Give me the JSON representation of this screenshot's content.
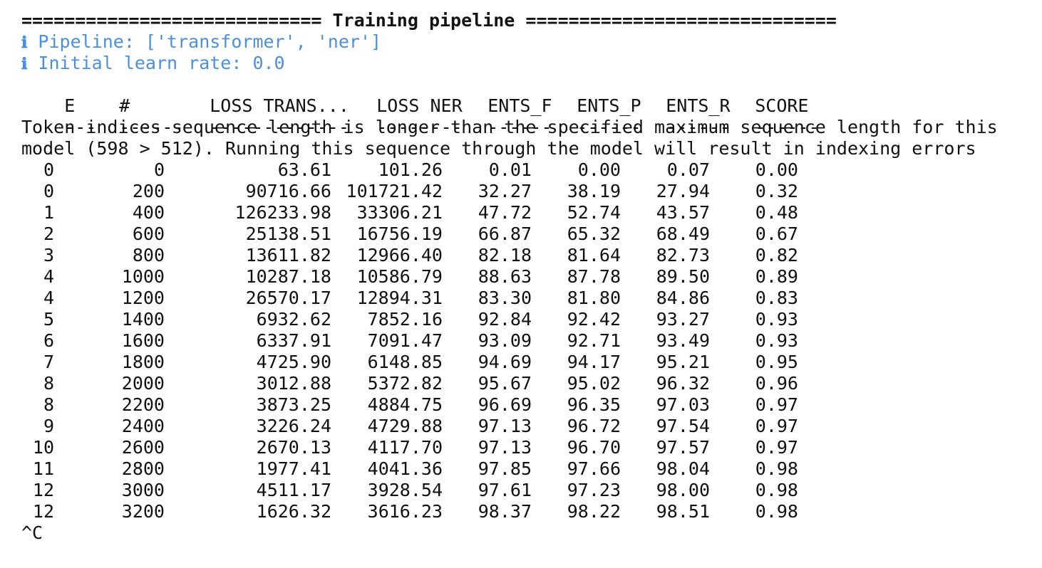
{
  "header": "============================ Training pipeline =============================",
  "info_icon": "ℹ",
  "info_lines": [
    "Pipeline: ['transformer', 'ner']",
    "Initial learn rate: 0.0"
  ],
  "table": {
    "columns": [
      "E",
      "#",
      "LOSS TRANS...",
      "LOSS NER",
      "ENTS_F",
      "ENTS_P",
      "ENTS_R",
      "SCORE"
    ],
    "separators": [
      "---",
      "------",
      "-------------",
      "--------",
      "------",
      "------",
      "------",
      "------"
    ],
    "rows": [
      [
        "0",
        "0",
        "63.61",
        "101.26",
        "0.01",
        "0.00",
        "0.07",
        "0.00"
      ],
      [
        "0",
        "200",
        "90716.66",
        "101721.42",
        "32.27",
        "38.19",
        "27.94",
        "0.32"
      ],
      [
        "1",
        "400",
        "126233.98",
        "33306.21",
        "47.72",
        "52.74",
        "43.57",
        "0.48"
      ],
      [
        "2",
        "600",
        "25138.51",
        "16756.19",
        "66.87",
        "65.32",
        "68.49",
        "0.67"
      ],
      [
        "3",
        "800",
        "13611.82",
        "12966.40",
        "82.18",
        "81.64",
        "82.73",
        "0.82"
      ],
      [
        "4",
        "1000",
        "10287.18",
        "10586.79",
        "88.63",
        "87.78",
        "89.50",
        "0.89"
      ],
      [
        "4",
        "1200",
        "26570.17",
        "12894.31",
        "83.30",
        "81.80",
        "84.86",
        "0.83"
      ],
      [
        "5",
        "1400",
        "6932.62",
        "7852.16",
        "92.84",
        "92.42",
        "93.27",
        "0.93"
      ],
      [
        "6",
        "1600",
        "6337.91",
        "7091.47",
        "93.09",
        "92.71",
        "93.49",
        "0.93"
      ],
      [
        "7",
        "1800",
        "4725.90",
        "6148.85",
        "94.69",
        "94.17",
        "95.21",
        "0.95"
      ],
      [
        "8",
        "2000",
        "3012.88",
        "5372.82",
        "95.67",
        "95.02",
        "96.32",
        "0.96"
      ],
      [
        "8",
        "2200",
        "3873.25",
        "4884.75",
        "96.69",
        "96.35",
        "97.03",
        "0.97"
      ],
      [
        "9",
        "2400",
        "3226.24",
        "4729.88",
        "97.13",
        "96.72",
        "97.54",
        "0.97"
      ],
      [
        "10",
        "2600",
        "2670.13",
        "4117.70",
        "97.13",
        "96.70",
        "97.57",
        "0.97"
      ],
      [
        "11",
        "2800",
        "1977.41",
        "4041.36",
        "97.85",
        "97.66",
        "98.04",
        "0.98"
      ],
      [
        "12",
        "3000",
        "4511.17",
        "3928.54",
        "97.61",
        "97.23",
        "98.00",
        "0.98"
      ],
      [
        "12",
        "3200",
        "1626.32",
        "3616.23",
        "98.37",
        "98.22",
        "98.51",
        "0.98"
      ]
    ]
  },
  "warning_lines": [
    "Token indices sequence length is longer than the specified maximum sequence length for this",
    "model (598 > 512). Running this sequence through the model will result in indexing errors"
  ],
  "footer": "^C",
  "colors": {
    "text": "#111111",
    "info": "#4a8fe0",
    "background": "#ffffff"
  }
}
